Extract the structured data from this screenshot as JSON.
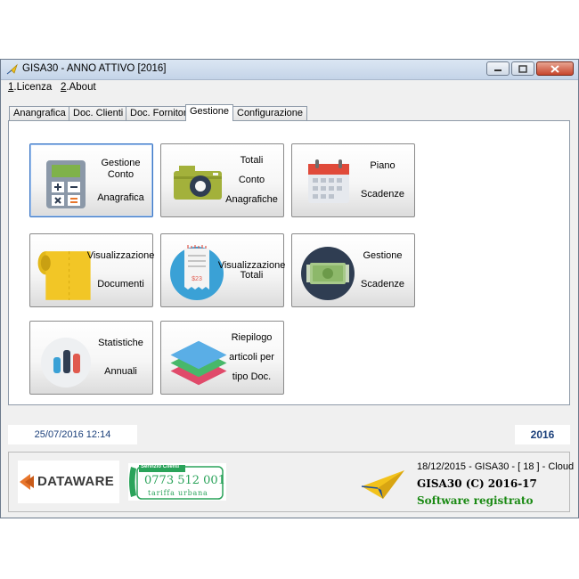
{
  "window": {
    "title": "GISA30 - ANNO ATTIVO  [2016]"
  },
  "menubar": {
    "items": [
      "1.Licenza",
      "2.About"
    ],
    "mnemonics": [
      "1",
      "2"
    ],
    "rest": [
      ".Licenza",
      ".About"
    ]
  },
  "tabs": [
    "Anangrafica",
    "Doc. Clienti",
    "Doc. Fornitori",
    "Gestione",
    "Configurazione"
  ],
  "active_tab": "Gestione",
  "tiles": [
    {
      "lines": [
        "Gestione Conto",
        "Anagrafica"
      ],
      "icon": "calculator-icon"
    },
    {
      "lines": [
        "Totali",
        "Conto",
        "Anagrafiche"
      ],
      "icon": "camera-icon"
    },
    {
      "lines": [
        "Piano",
        "Scadenze"
      ],
      "icon": "calendar-icon"
    },
    {
      "lines": [
        "Visualizzazione",
        "Documenti"
      ],
      "icon": "paper-roll-icon"
    },
    {
      "lines": [
        "Visualizzazione\nTotali"
      ],
      "icon": "receipt-icon"
    },
    {
      "lines": [
        "Gestione",
        "Scadenze"
      ],
      "icon": "banknote-icon"
    },
    {
      "lines": [
        "Statistiche",
        "Annuali"
      ],
      "icon": "bar-chart-icon"
    },
    {
      "lines": [
        "Riepilogo",
        "articoli per",
        "tipo Doc."
      ],
      "icon": "layers-icon"
    }
  ],
  "status": {
    "datetime": "25/07/2016  12:14",
    "year": "2016"
  },
  "footer": {
    "logo_text": "DATAWARE",
    "service_title": "Servizio Clienti",
    "phone": "0773 512 001",
    "tariff": "tariffa urbana",
    "build": "18/12/2015 - GISA30 - [ 18 ]  - Cloud",
    "copyright": "GISA30 (C) 2016-17",
    "registered": "Software registrato"
  },
  "colors": {
    "title_gradient_top": "#dbe6f3",
    "status_text": "#1a3f7a",
    "registered": "#1b8a14",
    "focus_border": "#3a75c4"
  }
}
